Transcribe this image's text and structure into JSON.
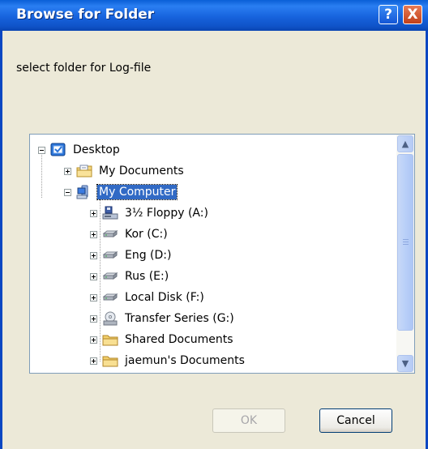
{
  "window": {
    "title": "Browse for Folder",
    "help_glyph": "?",
    "close_glyph": "X"
  },
  "prompt": "select folder for Log-file",
  "tree": {
    "items": [
      {
        "label": "Desktop",
        "icon": "desktop-icon",
        "expander": "minus"
      },
      {
        "label": "My Documents",
        "icon": "documents-folder-icon",
        "expander": "plus"
      },
      {
        "label": "My Computer",
        "icon": "computer-icon",
        "expander": "minus",
        "selected": true
      },
      {
        "label": "3½ Floppy (A:)",
        "icon": "floppy-drive-icon",
        "expander": "plus"
      },
      {
        "label": "Kor (C:)",
        "icon": "hard-drive-icon",
        "expander": "plus"
      },
      {
        "label": "Eng (D:)",
        "icon": "hard-drive-icon",
        "expander": "plus"
      },
      {
        "label": "Rus (E:)",
        "icon": "hard-drive-icon",
        "expander": "plus"
      },
      {
        "label": "Local Disk (F:)",
        "icon": "hard-drive-icon",
        "expander": "plus"
      },
      {
        "label": "Transfer Series (G:)",
        "icon": "cd-drive-icon",
        "expander": "plus"
      },
      {
        "label": "Shared Documents",
        "icon": "folder-icon",
        "expander": "plus"
      },
      {
        "label": "jaemun's Documents",
        "icon": "folder-icon",
        "expander": "plus"
      }
    ]
  },
  "buttons": {
    "ok": "OK",
    "cancel": "Cancel"
  },
  "colors": {
    "titlebar": "#0a5fd6",
    "selection": "#316ac5",
    "dialog_bg": "#ece9d8"
  }
}
